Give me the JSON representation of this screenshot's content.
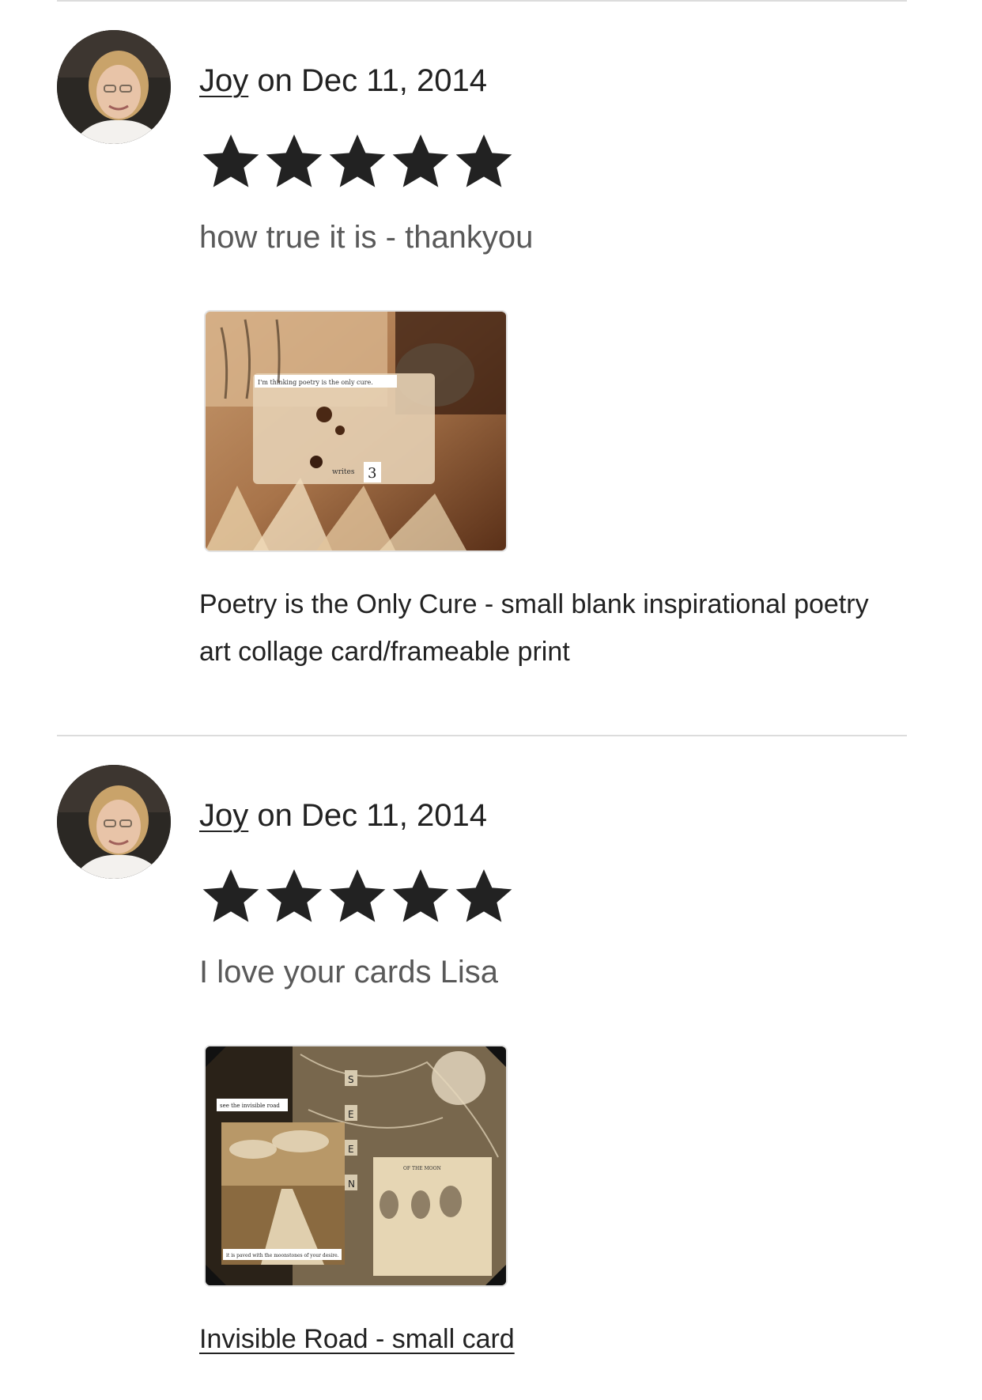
{
  "reviews": [
    {
      "reviewer": "Joy",
      "date_text": " on Dec 11, 2014",
      "rating": 5,
      "rating_max": 5,
      "text": "how true it is - thankyou",
      "listing_title": "Poetry is the Only Cure - small blank inspirational poetry art collage card/frameable print",
      "thumb_caption": "I'm thinking poetry is the only cure.",
      "thumb_tile_text": "writes",
      "thumb_tile_letter": "3"
    },
    {
      "reviewer": "Joy",
      "date_text": " on Dec 11, 2014",
      "rating": 5,
      "rating_max": 5,
      "text": "I love your cards Lisa",
      "listing_title": "Invisible Road - small card",
      "thumb_caption_top": "see the invisible road",
      "thumb_caption_bottom": "it is paved with the moonstones of your desire.",
      "thumb_tiles": [
        "S",
        "E",
        "E",
        "N"
      ],
      "thumb_page_heading": "OF THE MOON"
    }
  ],
  "icons": {
    "star": "star-icon",
    "avatar": "avatar"
  },
  "colors": {
    "text": "#222222",
    "muted": "#595959",
    "divider": "#dcdcdc"
  }
}
